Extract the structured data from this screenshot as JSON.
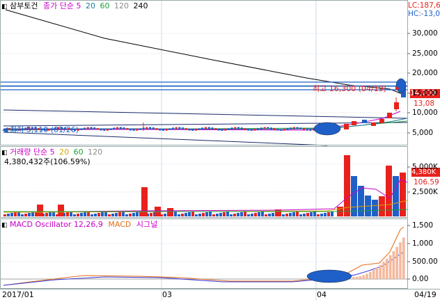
{
  "price_panel": {
    "stock_name": "삼부토건",
    "ma_title": "종가 단순",
    "ma_periods": [
      "5",
      "20",
      "60",
      "120",
      "240"
    ],
    "lc_label": "LC:187,6",
    "hc_label": "HC:-13,0",
    "y_ticks": [
      "30,000",
      "25,000",
      "20,000",
      "15,000",
      "10,000",
      "5,000"
    ],
    "high_annotation": "최고 16,300 (04/19)",
    "low_annotation": "최저 5,110 (01/26)",
    "current_price": "14,700",
    "secondary_price": "13,08"
  },
  "volume_panel": {
    "title": "거래량 단순",
    "ma_periods": [
      "5",
      "20",
      "60",
      "120"
    ],
    "volume_text": "4,380,432주(106.59%)",
    "y_ticks": [
      "5,000K",
      "2,500K"
    ],
    "current_volume": "4,380K",
    "current_ratio": "106.59"
  },
  "macd_panel": {
    "title": "MACD Oscillator 12,26,9",
    "macd_label": "MACD",
    "signal_label": "시그널",
    "y_ticks": [
      "1,500",
      "1,000",
      "500.00",
      "0.00"
    ]
  },
  "x_axis": {
    "labels": [
      "2017/01",
      "03",
      "04",
      "04/19"
    ]
  },
  "colors": {
    "up": "#e8211c",
    "down": "#1f5fc8",
    "ma5": "#c800c8",
    "ma20": "#d9a300",
    "ma60": "#1e9e3a",
    "ma120": "#8a8a8a",
    "ma240": "#000000",
    "macd": "#e2701c",
    "signal": "#3a3ad8",
    "osc": "#f5b89c",
    "grid": "#cfd8e3",
    "axis_text": "#333333"
  }
}
